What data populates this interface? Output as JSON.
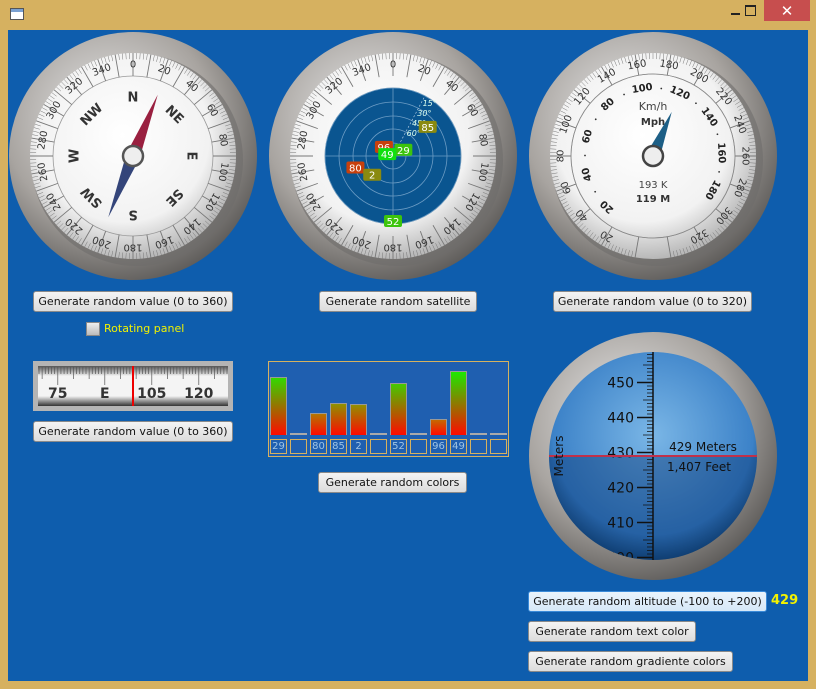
{
  "window": {
    "close_glyph": "✕"
  },
  "compass": {
    "heading": 22,
    "degree_labels": [
      "0",
      "20",
      "40",
      "60",
      "80",
      "100",
      "120",
      "140",
      "160",
      "180",
      "200",
      "220",
      "240",
      "260",
      "280",
      "300",
      "320",
      "340"
    ],
    "cardinals": [
      "N",
      "NE",
      "E",
      "SE",
      "S",
      "SW",
      "W",
      "NW"
    ],
    "button": "Generate random value (0 to 360)",
    "rotating_label": "Rotating panel",
    "rotating_checked": false
  },
  "linear_compass": {
    "value": 99,
    "labels": [
      {
        "deg": 75,
        "text": "75"
      },
      {
        "deg": 90,
        "text": "E"
      },
      {
        "deg": 105,
        "text": "105"
      },
      {
        "deg": 120,
        "text": "120"
      }
    ],
    "button": "Generate random value (0 to 360)"
  },
  "radar": {
    "button": "Generate random satellite",
    "elevation_labels": [
      "15°",
      "30°",
      "45°",
      "60°"
    ],
    "satellites": [
      {
        "id": "96",
        "az": 315,
        "el": 73,
        "color": "#c8400c"
      },
      {
        "id": "29",
        "az": 59,
        "el": 74,
        "color": "#3cc40c"
      },
      {
        "id": "49",
        "az": 288,
        "el": 82,
        "color": "#10e010"
      },
      {
        "id": "85",
        "az": 50,
        "el": 30,
        "color": "#8a8a10"
      },
      {
        "id": "80",
        "az": 253,
        "el": 38,
        "color": "#c8400c"
      },
      {
        "id": "2",
        "az": 228,
        "el": 53,
        "color": "#8a8a10"
      },
      {
        "id": "52",
        "az": 180,
        "el": 4,
        "color": "#3cc40c"
      }
    ]
  },
  "signal_bars": {
    "button": "Generate random colors",
    "items": [
      {
        "id": "29",
        "value": 56
      },
      {
        "id": "",
        "value": 0
      },
      {
        "id": "80",
        "value": 21
      },
      {
        "id": "85",
        "value": 31
      },
      {
        "id": "2",
        "value": 30
      },
      {
        "id": "",
        "value": 0
      },
      {
        "id": "52",
        "value": 51
      },
      {
        "id": "",
        "value": 0
      },
      {
        "id": "96",
        "value": 16
      },
      {
        "id": "49",
        "value": 62
      },
      {
        "id": "",
        "value": 0
      },
      {
        "id": "",
        "value": 0
      }
    ]
  },
  "speedometer": {
    "kmh": 193,
    "outer_labels": [
      "20",
      "40",
      "60",
      "80",
      "100",
      "120",
      "140",
      "160",
      "180",
      "200",
      "220",
      "240",
      "260",
      "280",
      "300",
      "320"
    ],
    "inner_labels": [
      "20",
      "40",
      "60",
      "80",
      "100",
      "120",
      "140",
      "160",
      "180"
    ],
    "unit_kmh": "Km/h",
    "unit_mph": "Mph",
    "readout_kmh": "193 K",
    "readout_mph": "119 M",
    "button": "Generate random value (0 to 320)"
  },
  "altimeter": {
    "meters": 429,
    "axis_label": "Meters",
    "readout_m": "429 Meters",
    "readout_ft": "1,407 Feet",
    "button_altitude": "Generate random altitude (-100 to +200)",
    "value_display": "429",
    "button_text_color": "Generate random text color",
    "button_gradient": "Generate random gradiente colors"
  }
}
